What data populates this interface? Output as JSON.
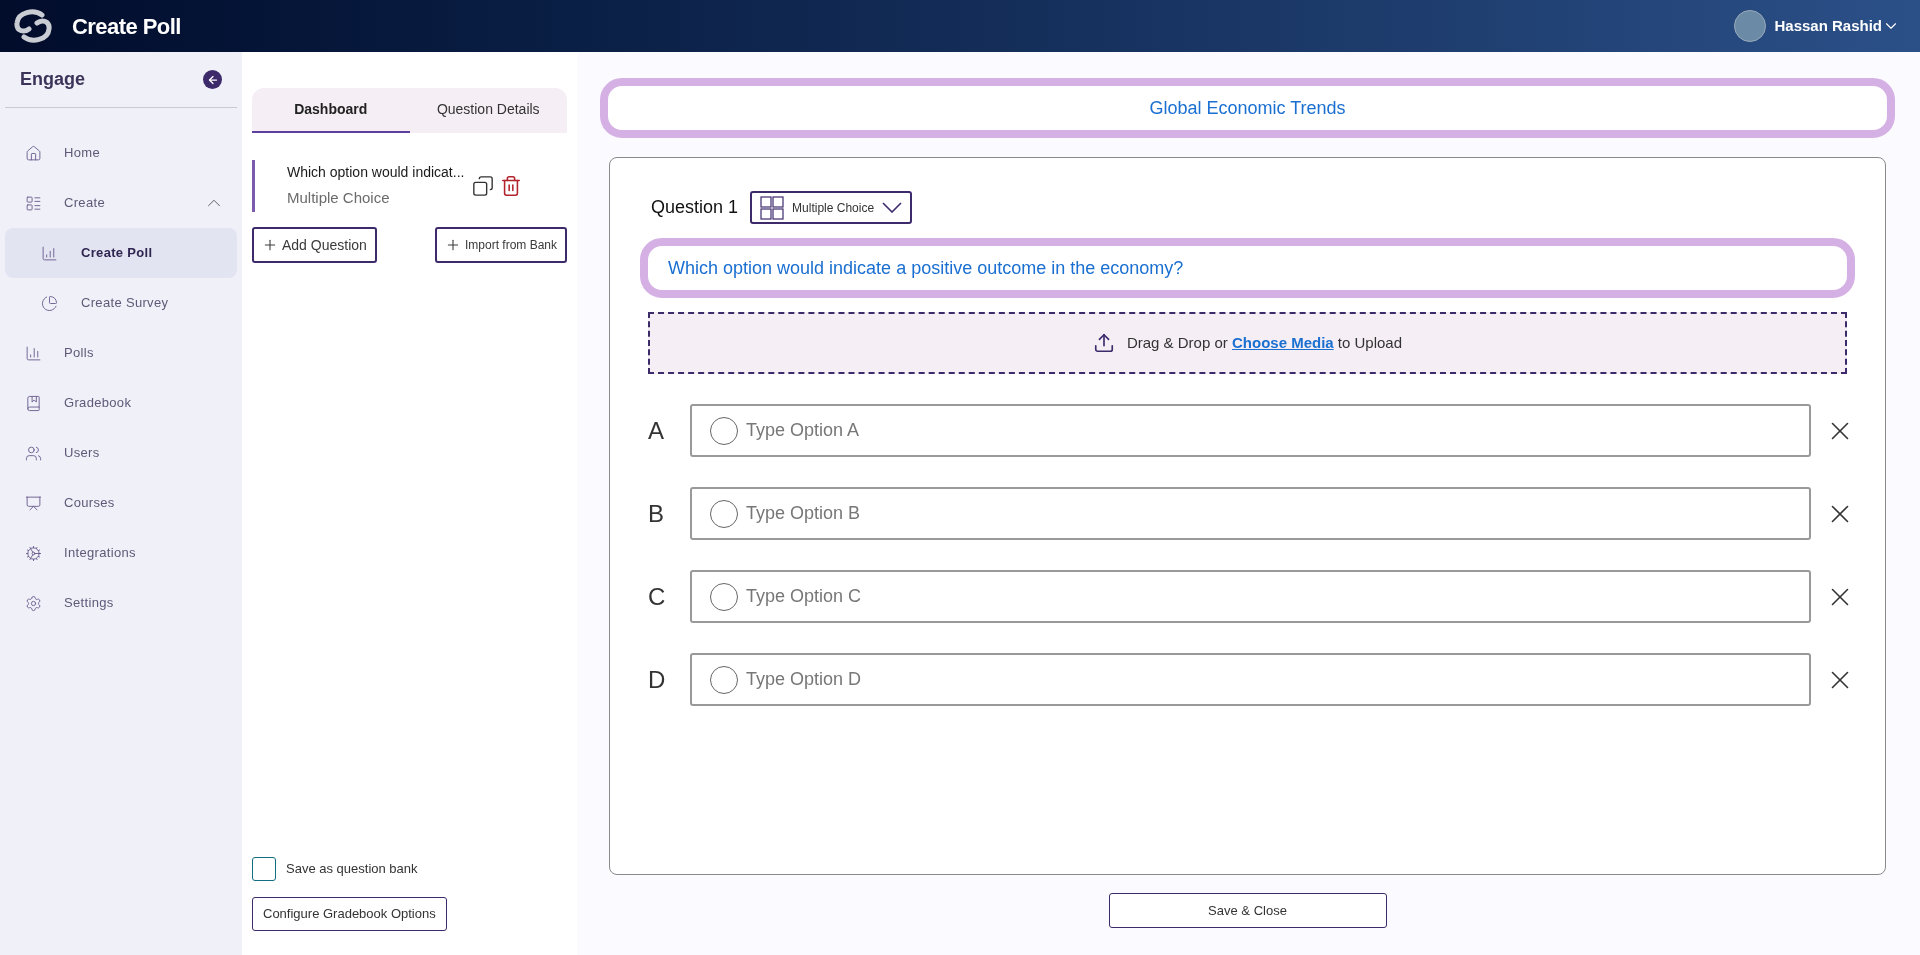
{
  "header": {
    "title": "Create Poll",
    "user": {
      "name": "Hassan Rashid"
    }
  },
  "sidebar": {
    "title": "Engage",
    "items": [
      {
        "label": "Home",
        "selected": false
      },
      {
        "label": "Create",
        "selected": false,
        "expanded": true,
        "children": [
          {
            "label": "Create Poll",
            "selected": true
          },
          {
            "label": "Create Survey",
            "selected": false
          }
        ]
      },
      {
        "label": "Polls",
        "selected": false
      },
      {
        "label": "Gradebook",
        "selected": false
      },
      {
        "label": "Users",
        "selected": false
      },
      {
        "label": "Courses",
        "selected": false
      },
      {
        "label": "Integrations",
        "selected": false
      },
      {
        "label": "Settings",
        "selected": false
      }
    ]
  },
  "panel": {
    "tabs": [
      {
        "label": "Dashboard",
        "selected": true
      },
      {
        "label": "Question Details",
        "selected": false
      }
    ],
    "questions": [
      {
        "title": "Which option would indicat...",
        "type": "Multiple Choice",
        "selected": true
      }
    ],
    "buttons": [
      "Add Question",
      "Import from Bank"
    ],
    "save_as_bank": {
      "label": "Save as question bank",
      "checked": false
    },
    "configure_button": "Configure Gradebook Options"
  },
  "editor": {
    "poll_title": "Global Economic Trends",
    "question": {
      "label": "Question 1",
      "type": "Multiple Choice",
      "text": "Which option would indicate a positive outcome in the economy?"
    },
    "upload": {
      "before": "Drag & Drop or",
      "link": "Choose Media",
      "after": "to Upload"
    },
    "options": [
      {
        "letter": "A",
        "placeholder": "Type Option A",
        "selected": false
      },
      {
        "letter": "B",
        "placeholder": "Type Option B",
        "selected": false
      },
      {
        "letter": "C",
        "placeholder": "Type Option C",
        "selected": false
      },
      {
        "letter": "D",
        "placeholder": "Type Option D",
        "selected": false
      }
    ],
    "save_button": "Save & Close"
  }
}
